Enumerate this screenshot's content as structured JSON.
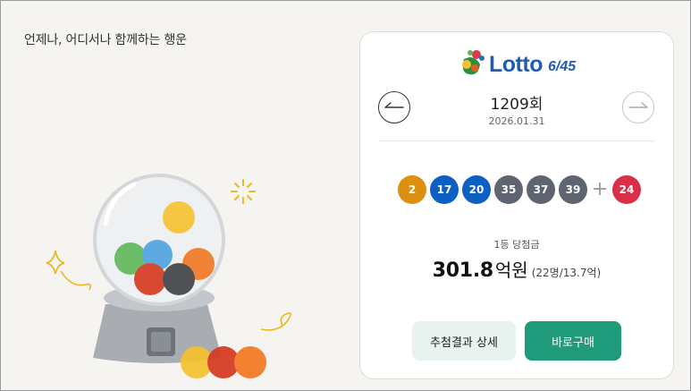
{
  "tagline": "언제나, 어디서나 함께하는 행운",
  "logo": {
    "text": "Lotto",
    "sub": "6/45"
  },
  "draw": {
    "round": "1209회",
    "date": "2026.01.31"
  },
  "numbers": [
    {
      "value": "2",
      "color": "#dd8f10"
    },
    {
      "value": "17",
      "color": "#0e5fc4"
    },
    {
      "value": "20",
      "color": "#0e5fc4"
    },
    {
      "value": "35",
      "color": "#5e6470"
    },
    {
      "value": "37",
      "color": "#5e6470"
    },
    {
      "value": "39",
      "color": "#5e6470"
    }
  ],
  "plus": "+",
  "bonus": {
    "value": "24",
    "color": "#d9304a"
  },
  "prize": {
    "label": "1등 당첨금",
    "amount": "301.8",
    "unit": "억원",
    "detail": "(22명/13.7억)"
  },
  "buttons": {
    "detail": "추첨결과 상세",
    "buy": "바로구매"
  },
  "colors": {
    "accent": "#1f9a7a",
    "accent_light": "#e8f3ef",
    "logo_blue": "#1f5db3"
  },
  "icons": {
    "prev": "arrow-left-icon",
    "next": "arrow-right-icon"
  }
}
